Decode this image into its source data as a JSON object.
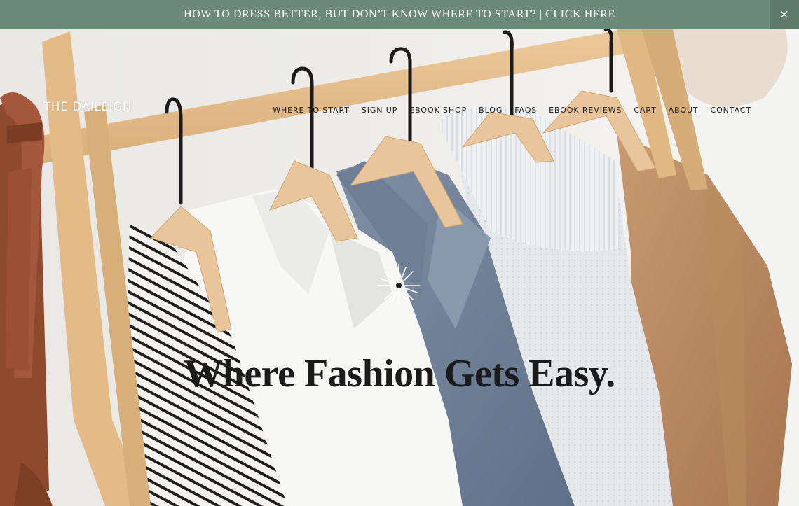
{
  "announcement": {
    "text": "HOW TO DRESS BETTER, BUT DON’T KNOW WHERE TO START? | CLICK HERE",
    "close_label": "×",
    "background": "#6b8a78"
  },
  "header": {
    "logo": "THE DAILEIGH",
    "nav": [
      {
        "label": "WHERE TO START"
      },
      {
        "label": "SIGN UP"
      },
      {
        "label": "EBOOK SHOP"
      },
      {
        "label": "BLOG"
      },
      {
        "label": "FAQS"
      },
      {
        "label": "EBOOK REVIEWS"
      },
      {
        "label": "CART"
      },
      {
        "label": "ABOUT"
      },
      {
        "label": "CONTACT"
      }
    ]
  },
  "hero": {
    "headline": "Where Fashion Gets Easy.",
    "icon": "sparkle-icon",
    "image": "clothes-rack-photo"
  }
}
